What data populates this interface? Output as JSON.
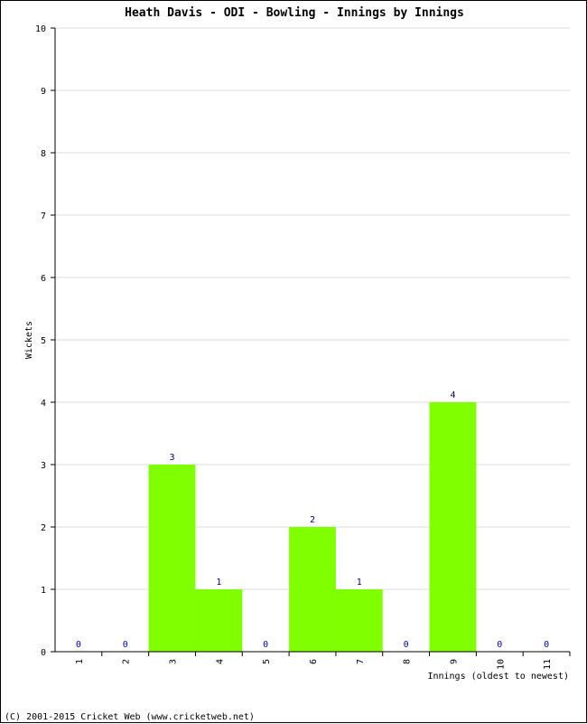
{
  "chart_data": {
    "type": "bar",
    "title": "Heath Davis - ODI - Bowling - Innings by Innings",
    "xlabel": "Innings (oldest to newest)",
    "ylabel": "Wickets",
    "categories": [
      "1",
      "2",
      "3",
      "4",
      "5",
      "6",
      "7",
      "8",
      "9",
      "10",
      "11"
    ],
    "values": [
      0,
      0,
      3,
      1,
      0,
      2,
      1,
      0,
      4,
      0,
      0
    ],
    "ylim": [
      0,
      10
    ],
    "yticks": [
      "0",
      "1",
      "2",
      "3",
      "4",
      "5",
      "6",
      "7",
      "8",
      "9",
      "10"
    ],
    "grid": true,
    "bar_color": "#80ff00",
    "label_color": "#000080",
    "zero_label_color": "#0000cc"
  },
  "footer": "(C) 2001-2015 Cricket Web (www.cricketweb.net)"
}
